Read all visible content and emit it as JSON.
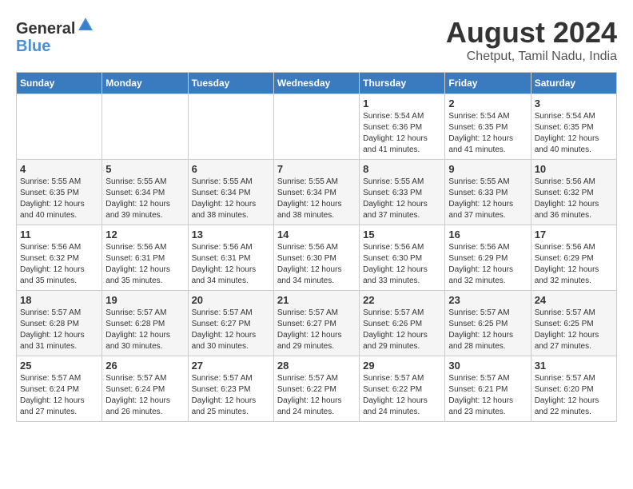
{
  "logo": {
    "line1": "General",
    "line2": "Blue"
  },
  "title": "August 2024",
  "subtitle": "Chetput, Tamil Nadu, India",
  "days_header": [
    "Sunday",
    "Monday",
    "Tuesday",
    "Wednesday",
    "Thursday",
    "Friday",
    "Saturday"
  ],
  "weeks": [
    [
      {
        "day": "",
        "info": ""
      },
      {
        "day": "",
        "info": ""
      },
      {
        "day": "",
        "info": ""
      },
      {
        "day": "",
        "info": ""
      },
      {
        "day": "1",
        "info": "Sunrise: 5:54 AM\nSunset: 6:36 PM\nDaylight: 12 hours\nand 41 minutes."
      },
      {
        "day": "2",
        "info": "Sunrise: 5:54 AM\nSunset: 6:35 PM\nDaylight: 12 hours\nand 41 minutes."
      },
      {
        "day": "3",
        "info": "Sunrise: 5:54 AM\nSunset: 6:35 PM\nDaylight: 12 hours\nand 40 minutes."
      }
    ],
    [
      {
        "day": "4",
        "info": "Sunrise: 5:55 AM\nSunset: 6:35 PM\nDaylight: 12 hours\nand 40 minutes."
      },
      {
        "day": "5",
        "info": "Sunrise: 5:55 AM\nSunset: 6:34 PM\nDaylight: 12 hours\nand 39 minutes."
      },
      {
        "day": "6",
        "info": "Sunrise: 5:55 AM\nSunset: 6:34 PM\nDaylight: 12 hours\nand 38 minutes."
      },
      {
        "day": "7",
        "info": "Sunrise: 5:55 AM\nSunset: 6:34 PM\nDaylight: 12 hours\nand 38 minutes."
      },
      {
        "day": "8",
        "info": "Sunrise: 5:55 AM\nSunset: 6:33 PM\nDaylight: 12 hours\nand 37 minutes."
      },
      {
        "day": "9",
        "info": "Sunrise: 5:55 AM\nSunset: 6:33 PM\nDaylight: 12 hours\nand 37 minutes."
      },
      {
        "day": "10",
        "info": "Sunrise: 5:56 AM\nSunset: 6:32 PM\nDaylight: 12 hours\nand 36 minutes."
      }
    ],
    [
      {
        "day": "11",
        "info": "Sunrise: 5:56 AM\nSunset: 6:32 PM\nDaylight: 12 hours\nand 35 minutes."
      },
      {
        "day": "12",
        "info": "Sunrise: 5:56 AM\nSunset: 6:31 PM\nDaylight: 12 hours\nand 35 minutes."
      },
      {
        "day": "13",
        "info": "Sunrise: 5:56 AM\nSunset: 6:31 PM\nDaylight: 12 hours\nand 34 minutes."
      },
      {
        "day": "14",
        "info": "Sunrise: 5:56 AM\nSunset: 6:30 PM\nDaylight: 12 hours\nand 34 minutes."
      },
      {
        "day": "15",
        "info": "Sunrise: 5:56 AM\nSunset: 6:30 PM\nDaylight: 12 hours\nand 33 minutes."
      },
      {
        "day": "16",
        "info": "Sunrise: 5:56 AM\nSunset: 6:29 PM\nDaylight: 12 hours\nand 32 minutes."
      },
      {
        "day": "17",
        "info": "Sunrise: 5:56 AM\nSunset: 6:29 PM\nDaylight: 12 hours\nand 32 minutes."
      }
    ],
    [
      {
        "day": "18",
        "info": "Sunrise: 5:57 AM\nSunset: 6:28 PM\nDaylight: 12 hours\nand 31 minutes."
      },
      {
        "day": "19",
        "info": "Sunrise: 5:57 AM\nSunset: 6:28 PM\nDaylight: 12 hours\nand 30 minutes."
      },
      {
        "day": "20",
        "info": "Sunrise: 5:57 AM\nSunset: 6:27 PM\nDaylight: 12 hours\nand 30 minutes."
      },
      {
        "day": "21",
        "info": "Sunrise: 5:57 AM\nSunset: 6:27 PM\nDaylight: 12 hours\nand 29 minutes."
      },
      {
        "day": "22",
        "info": "Sunrise: 5:57 AM\nSunset: 6:26 PM\nDaylight: 12 hours\nand 29 minutes."
      },
      {
        "day": "23",
        "info": "Sunrise: 5:57 AM\nSunset: 6:25 PM\nDaylight: 12 hours\nand 28 minutes."
      },
      {
        "day": "24",
        "info": "Sunrise: 5:57 AM\nSunset: 6:25 PM\nDaylight: 12 hours\nand 27 minutes."
      }
    ],
    [
      {
        "day": "25",
        "info": "Sunrise: 5:57 AM\nSunset: 6:24 PM\nDaylight: 12 hours\nand 27 minutes."
      },
      {
        "day": "26",
        "info": "Sunrise: 5:57 AM\nSunset: 6:24 PM\nDaylight: 12 hours\nand 26 minutes."
      },
      {
        "day": "27",
        "info": "Sunrise: 5:57 AM\nSunset: 6:23 PM\nDaylight: 12 hours\nand 25 minutes."
      },
      {
        "day": "28",
        "info": "Sunrise: 5:57 AM\nSunset: 6:22 PM\nDaylight: 12 hours\nand 24 minutes."
      },
      {
        "day": "29",
        "info": "Sunrise: 5:57 AM\nSunset: 6:22 PM\nDaylight: 12 hours\nand 24 minutes."
      },
      {
        "day": "30",
        "info": "Sunrise: 5:57 AM\nSunset: 6:21 PM\nDaylight: 12 hours\nand 23 minutes."
      },
      {
        "day": "31",
        "info": "Sunrise: 5:57 AM\nSunset: 6:20 PM\nDaylight: 12 hours\nand 22 minutes."
      }
    ]
  ]
}
